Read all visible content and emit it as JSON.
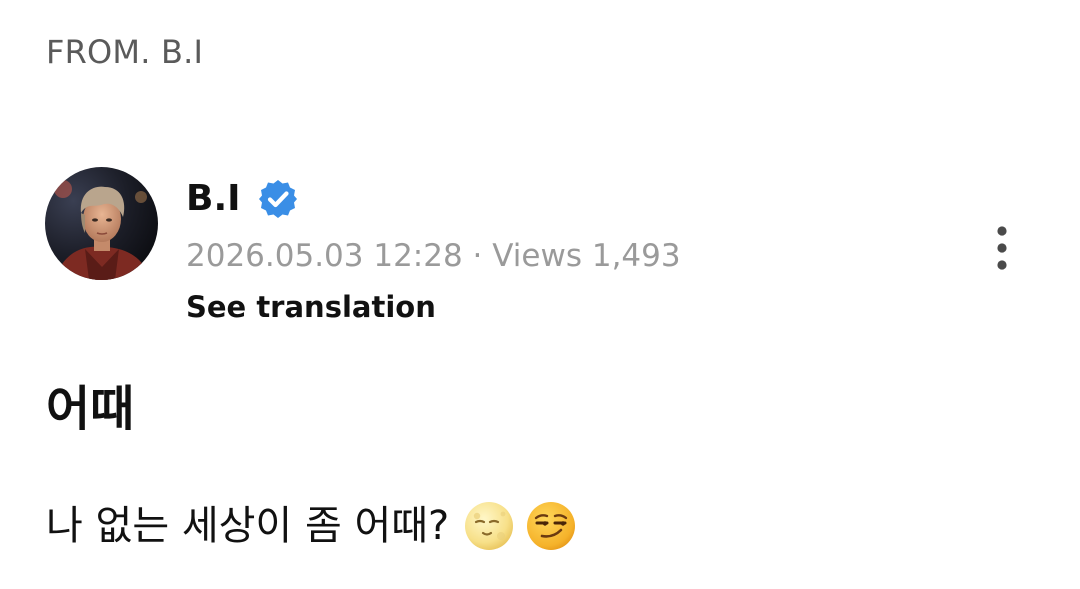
{
  "section_label": "FROM. B.I",
  "post": {
    "author": {
      "name": "B.I",
      "verified": true,
      "avatar": "profile-photo"
    },
    "date": "2026.05.03 12:28",
    "separator": "·",
    "views_label": "Views",
    "views": "1,493",
    "translate_label": "See translation",
    "title": "어때",
    "body": "나 없는 세상이 좀 어때?",
    "emojis": [
      "new-moon-with-face-emoji",
      "smirking-face-emoji"
    ]
  },
  "icons": {
    "verified": "verified-check-icon",
    "more": "more-vertical-icon"
  },
  "colors": {
    "verified_blue": "#3a8ee6",
    "meta_gray": "#9a9a9a",
    "label_gray": "#5a5a5a"
  }
}
